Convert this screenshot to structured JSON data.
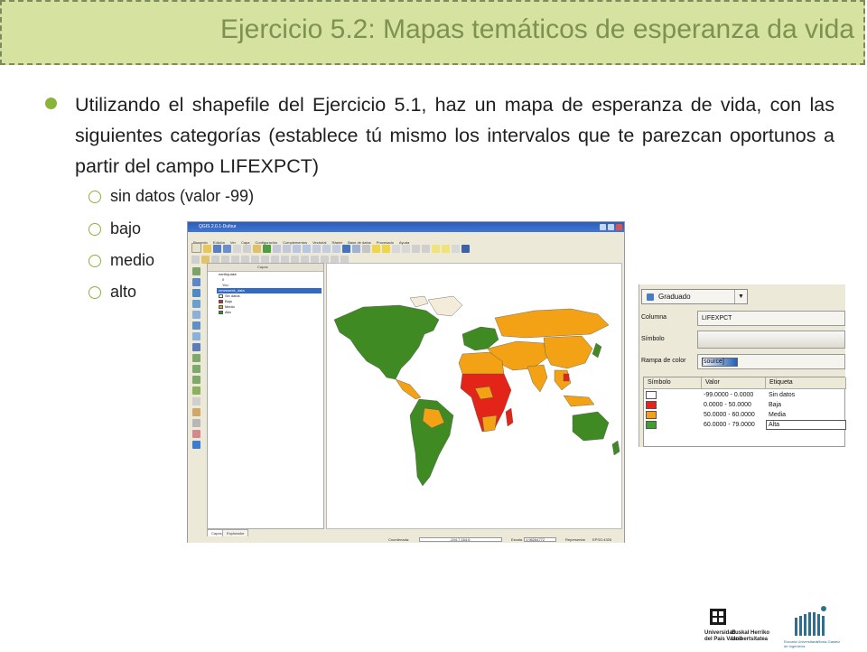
{
  "header": {
    "title": "Ejercicio 5.2: Mapas temáticos de esperanza da vida"
  },
  "content": {
    "main_bullet": "Utilizando el shapefile del Ejercicio 5.1, haz un mapa de esperanza de vida, con las siguientes categorías (establece tú mismo los intervalos que te parezcan oportunos a partir del campo LIFEXPCT)",
    "sub_bullets": [
      "sin datos (valor -99)",
      "bajo",
      "medio",
      "alto"
    ]
  },
  "qgis": {
    "window_title": "QGIS 2.0.1-Dufour",
    "menu": [
      "Proyecto",
      "Edición",
      "Ver",
      "Capa",
      "Configuración",
      "Complementos",
      "Vectorial",
      "Ráster",
      "Base de datos",
      "Procesado",
      "Ayuda"
    ],
    "layers_panel_title": "Capas",
    "layers": [
      {
        "name": "earthquake",
        "children": [
          "0",
          "You"
        ]
      },
      {
        "name": "newsweek_data",
        "children": [
          "Sin datos",
          "Bajo",
          "Medio",
          "Alto"
        ]
      }
    ],
    "tabs": [
      "Capas",
      "Explorador"
    ],
    "status": {
      "coord_label": "Coordenada:",
      "coord_value": "-194.7,164.6",
      "scale_label": "Escala",
      "scale_value": "1:98264772",
      "render_label": "Representar",
      "crs": "EPSG:4326"
    }
  },
  "legend_panel": {
    "renderer": "Graduado",
    "column_label": "Columna",
    "column_value": "LIFEXPCT",
    "symbol_label": "Símbolo",
    "ramp_label": "Rampa de color",
    "ramp_value": "[source]",
    "headers": [
      "Símbolo",
      "Valor",
      "Etiqueta"
    ],
    "rows": [
      {
        "value": "-99.0000 - 0.0000",
        "label": "Sin datos",
        "color": "#ffffff"
      },
      {
        "value": "0.0000 - 50.0000",
        "label": "Baja",
        "color": "#e8211b"
      },
      {
        "value": "50.0000 - 60.0000",
        "label": "Media",
        "color": "#f6a01a"
      },
      {
        "value": "60.0000 - 79.0000",
        "label": "Alta",
        "color": "#3f9e2d"
      }
    ]
  },
  "logos": {
    "upv": [
      "Universidad",
      "del País Vasco",
      "Euskal Herriko",
      "Unibertsitatea"
    ],
    "eui": [
      "Escuela Universitaria",
      "de Ingeniería",
      "Vitoria-Gasteiz"
    ]
  },
  "colors": {
    "header_bg": "#d6e3a0",
    "title": "#7e9150",
    "bullet": "#8ab33a",
    "map_green": "#3f8a22",
    "map_orange": "#f3a115",
    "map_red": "#e32419",
    "map_nodata": "#f3ecd8"
  }
}
